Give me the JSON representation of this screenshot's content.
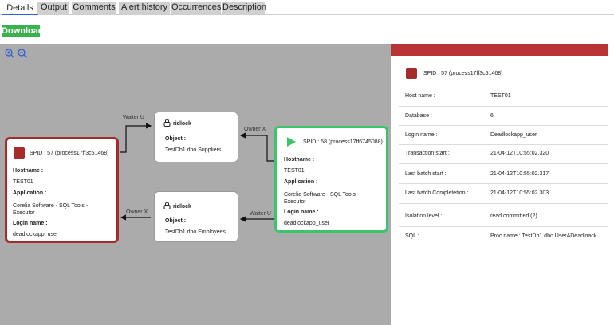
{
  "tabs": [
    {
      "label": "Details",
      "active": true
    },
    {
      "label": "Output"
    },
    {
      "label": "Comments"
    },
    {
      "label": "Alert history"
    },
    {
      "label": "Occurrences"
    },
    {
      "label": "Description"
    }
  ],
  "download_label": "Download",
  "colors": {
    "victim": "#a62b2b",
    "survivor": "#3cc46b",
    "download": "#39b24e",
    "panel_header": "#b93434"
  },
  "graph": {
    "victim": {
      "spid": "SPID : 57 (process17ff3c51468)",
      "hostname_label": "Hostname :",
      "hostname": "TEST01",
      "application_label": "Application :",
      "application": "Corelia Software - SQL Tools - Executor",
      "login_label": "Login name :",
      "login": "deadlockapp_user"
    },
    "survivor": {
      "spid": "SPID : 58 (process17ff6745088)",
      "hostname_label": "Hostname :",
      "hostname": "TEST01",
      "application_label": "Application :",
      "application": "Corelia Software - SQL Tools - Executor",
      "login_label": "Login name :",
      "login": "deadlockapp_user"
    },
    "resource1": {
      "lock": "ridlock",
      "object_label": "Object :",
      "object": "TestDb1.dbo.Suppliers"
    },
    "resource2": {
      "lock": "ridlock",
      "object_label": "Object :",
      "object": "TestDb1.dbo.Employees"
    },
    "edges": {
      "waiter1": "Waiter U",
      "owner1": "Owner X",
      "owner2": "Owner X",
      "waiter2": "Waiter U"
    }
  },
  "details": {
    "spid": "SPID : 57 (process17ff3c51468)",
    "rows": [
      {
        "label": "Host name :",
        "value": "TEST01"
      },
      {
        "label": "Database :",
        "value": "6"
      },
      {
        "label": "Login name :",
        "value": "Deadlockapp_user"
      },
      {
        "label": "Transaction start :",
        "value": "21-04-12T10:55:02.320"
      },
      {
        "label": "Last batch start :",
        "value": "21-04-12T10:55:02.317"
      },
      {
        "label": "Last batch Completetion :",
        "value": "21-04-12T10:55:02.303"
      },
      {
        "label": "Isolation level :",
        "value": "read committed (2)"
      },
      {
        "label": "SQL :",
        "value": "Proc name : TestDb1.dbo.UserADeadloack"
      }
    ]
  }
}
